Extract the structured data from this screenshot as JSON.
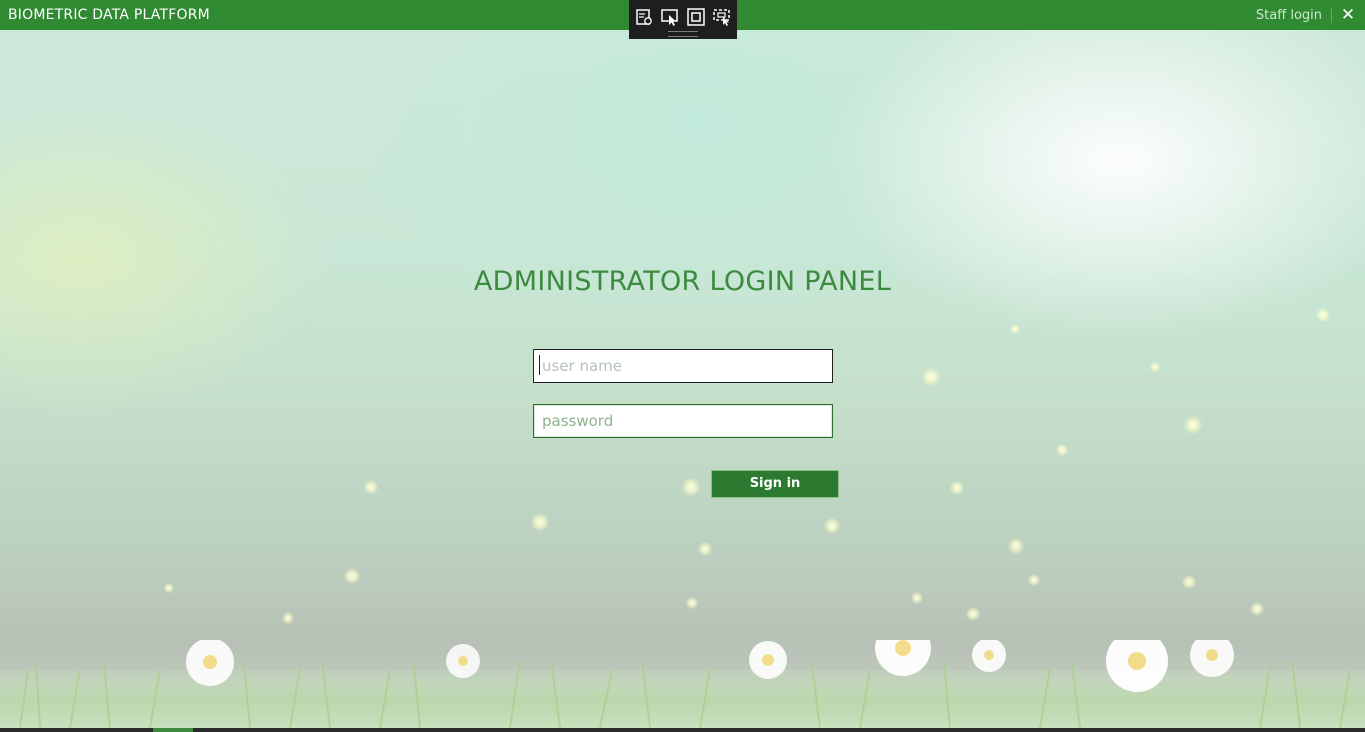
{
  "window": {
    "title": "BIOMETRIC DATA PLATFORM",
    "staff_login_link": "Staff login",
    "close_glyph": "✕",
    "accent_color": "#2f8a32"
  },
  "debug_toolbar": {
    "buttons": [
      {
        "icon": "live-visual-tree-icon"
      },
      {
        "icon": "select-element-icon"
      },
      {
        "icon": "display-layout-adorners-icon"
      },
      {
        "icon": "track-focused-element-icon"
      }
    ],
    "background": "#1e1e1e"
  },
  "login": {
    "heading": "ADMINISTRATOR LOGIN PANEL",
    "username_placeholder": "user name",
    "password_placeholder": "password",
    "sign_in_label": "Sign in",
    "heading_color": "#3d8a3f",
    "button_color": "#2b7a2f"
  }
}
